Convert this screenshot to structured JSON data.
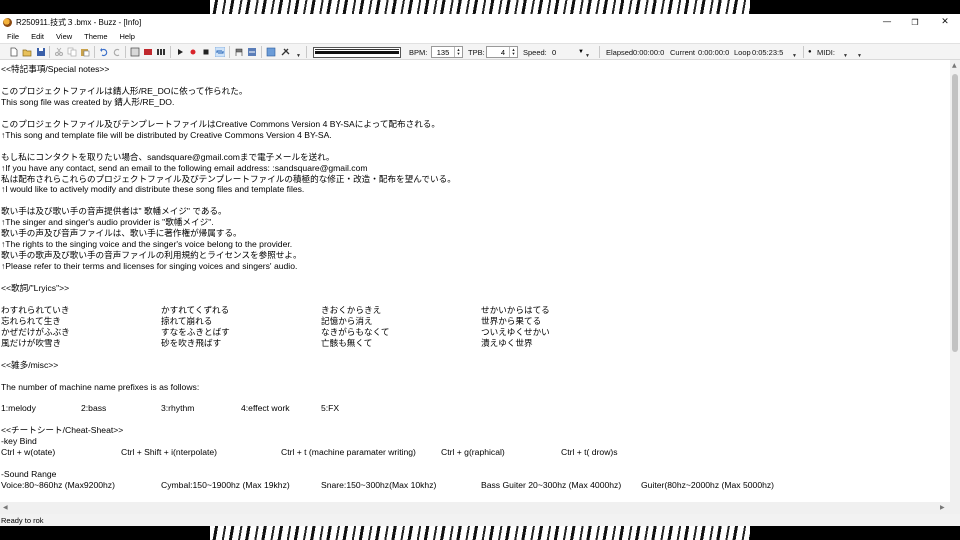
{
  "window": {
    "title": "R250911.技式３.bmx - Buzz - [Info]"
  },
  "menu": [
    "File",
    "Edit",
    "View",
    "Theme",
    "Help"
  ],
  "toolbar": {
    "bpm_label": "BPM:",
    "bpm_value": "135",
    "tpb_label": "TPB:",
    "tpb_value": "4",
    "speed_label": "Speed:",
    "speed_value": "0",
    "elapsed_label": "Elapsed",
    "elapsed_value": "0:00:00:0",
    "current_label": "Current",
    "current_value": "0:00:00:0",
    "loop_label": "Loop",
    "loop_value": "0:05:23:5",
    "midi_label": "MIDI:"
  },
  "info_lines": [
    "<<特記事項/Special notes>>",
    "",
    "このプロジェクトファイルは錆人形/RE_DOに依って作られた。",
    "This song file was created by 錆人形/RE_DO.",
    "",
    "このプロジェクトファイル及びテンプレートファイルはCreative Commons Version 4 BY-SAによって配布される。",
    "↑This song and template file will be distributed by Creative Commons Version 4 BY-SA.",
    "",
    "もし私にコンタクトを取りたい場合、sandsquare@gmail.comまで電子メールを送れ。",
    "↑If you have any contact, send an email to the following email address: :sandsquare@gmail.com",
    "私は配布されらこれらのプロジェクトファイル及びテンプレートファイルの積極的な修正・改造・配布を望んでいる。",
    "↑I would like to actively modify and distribute these song files and template files.",
    "",
    "歌い手は及び歌い手の音声提供者は\" 歌幡メイジ\" である。",
    "↑The singer and singer's audio provider is \"歌幡メイジ\".",
    "歌い手の声及び音声ファイルは、歌い手に著作権が帰属する。",
    "↑The rights to the singing voice and the singer's voice belong to the provider.",
    "歌い手の歌声及び歌い手の音声ファイルの利用規約とライセンスを参照せよ。",
    "↑Please refer to their terms and licenses for singing voices and singers' audio.",
    "",
    "<<歌詞/\"Lryics\">>",
    "",
    "",
    "",
    "",
    "",
    "",
    "<<雑多/misc>>",
    "",
    "The number of machine name prefixes is as follows:",
    "",
    "",
    "",
    "<<チートシート/Cheat-Sheat>>",
    "-key Bind",
    "",
    "",
    "-Sound Range",
    ""
  ],
  "lyrics": [
    [
      "わすれられていき",
      "かすれてくずれる",
      "きおくからきえ",
      "せかいからはてる"
    ],
    [
      "忘れられて生き",
      "掠れて崩れる",
      "記憶から消え",
      "世界から果てる"
    ],
    [
      "かぜだけがふぶき",
      "すなをふきとばす",
      "なきがらもなくて",
      "ついえゆくせかい"
    ],
    [
      "風だけが吹雪き",
      "砂を吹き飛ばす",
      "亡骸も無くて",
      "潰えゆく世界"
    ]
  ],
  "prefixes": [
    "1:melody",
    "2:bass",
    "3:rhythm",
    "4:effect work",
    "5:FX"
  ],
  "keybinds": [
    "Ctrl + w(otate)",
    "Ctrl + Shift + i(nterpolate)",
    "Ctrl + t (machine paramater writing)",
    "Ctrl + g(raphical)",
    "Ctrl + t( drow)s"
  ],
  "sound_ranges": [
    "Voice:80~860hz (Max9200hz)",
    "Cymbal:150~1900hz (Max 19khz)",
    "Snare:150~300hz(Max 10khz)",
    "Bass Guiter 20~300hz (Max 4000hz)",
    "Guiter(80hz~2000hz (Max 5000hz)"
  ],
  "status": {
    "text": "Ready to rok"
  }
}
